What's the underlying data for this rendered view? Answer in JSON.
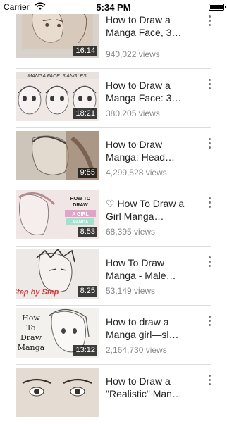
{
  "status_bar": {
    "carrier": "Carrier",
    "time": "5:34 PM"
  },
  "videos": [
    {
      "title": "How to Draw a Manga Face, 3…",
      "duration": "16:14",
      "views": "940,022 views",
      "thumb_text": ""
    },
    {
      "title": "How to Draw a Manga Face: 3…",
      "duration": "18:21",
      "views": "380,205 views",
      "thumb_text": "MANGA FACE: 3 ANGLES"
    },
    {
      "title": "How to Draw Manga: Head…",
      "duration": "9:55",
      "views": "4,299,528 views",
      "thumb_text": ""
    },
    {
      "title": "♡ How To Draw a Girl Manga…",
      "duration": "8:53",
      "views": "68,395 views",
      "thumb_text": "HOW TO DRAW A GIRL MANGA"
    },
    {
      "title": "How To Draw Manga - Male…",
      "duration": "8:25",
      "views": "53,149 views",
      "thumb_text": "Step by Step"
    },
    {
      "title": "How to draw a Manga girl—sl…",
      "duration": "13:12",
      "views": "2,164,730 views",
      "thumb_text": "How To Draw Manga"
    },
    {
      "title": "How to Draw a \"Realistic\" Man…",
      "duration": "",
      "views": "",
      "thumb_text": ""
    }
  ]
}
